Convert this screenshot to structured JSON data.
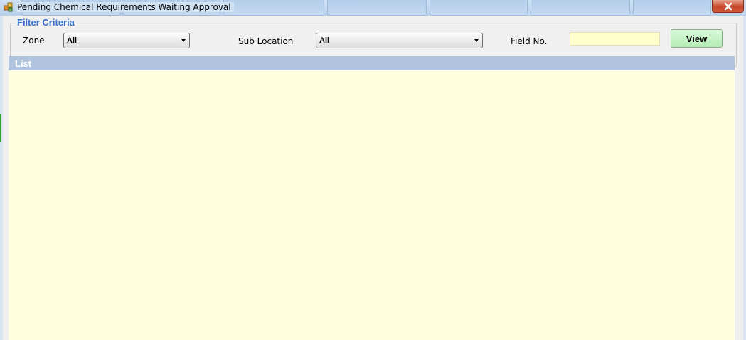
{
  "window": {
    "title": "Pending Chemical Requirements Waiting Approval",
    "icon": "app-window-icon",
    "close_icon": "close-x-icon"
  },
  "filter": {
    "legend": "Filter Criteria",
    "zone_label": "Zone",
    "zone_value": "All",
    "sublocation_label": "Sub Location",
    "sublocation_value": "All",
    "fieldno_label": "Field No.",
    "fieldno_value": "",
    "view_button": "View"
  },
  "list": {
    "header": "List",
    "rows": []
  },
  "colors": {
    "list_header_bg": "#b0c4de",
    "list_body_bg": "#ffffe0",
    "legend_text": "#3a6fc7",
    "view_button_bg": "#c6f2c6",
    "field_input_bg": "#ffffcc"
  }
}
